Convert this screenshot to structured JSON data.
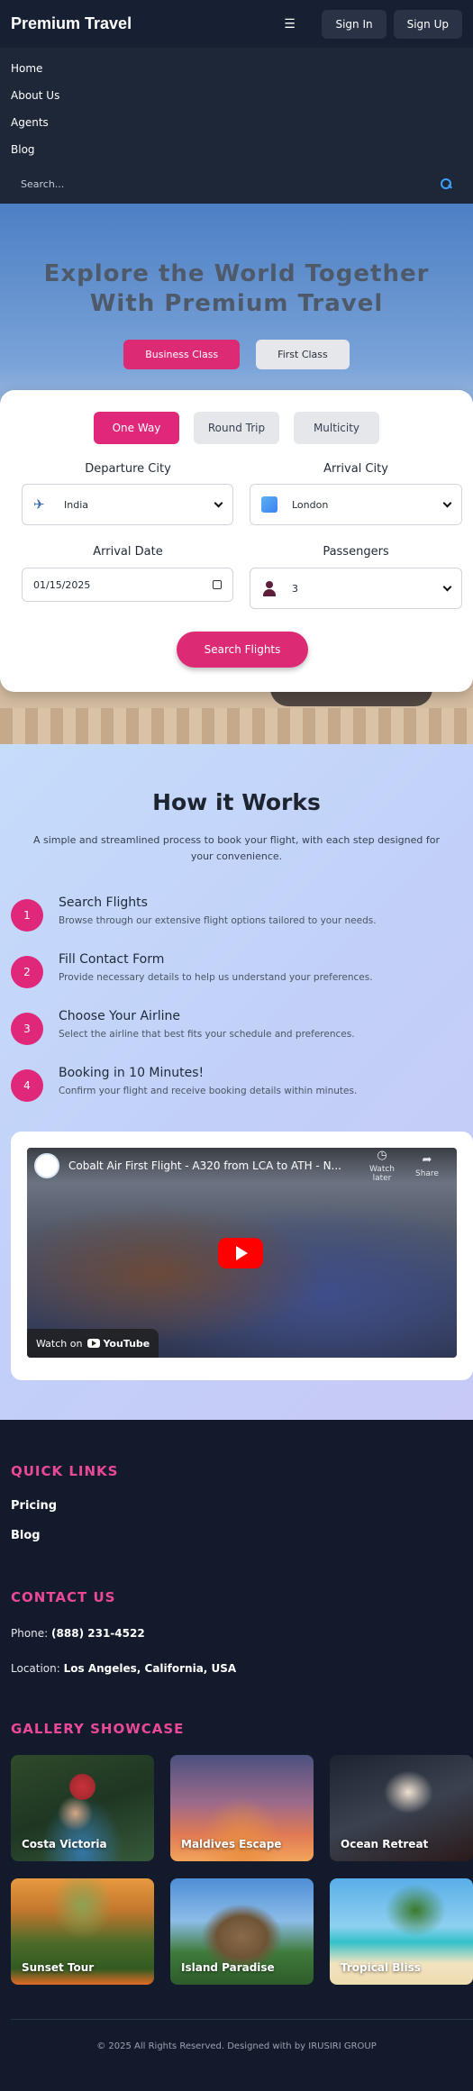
{
  "header": {
    "brand": "Premium Travel",
    "menu_icon": "hamburger-icon",
    "sign_in": "Sign In",
    "sign_up": "Sign Up"
  },
  "nav": {
    "items": [
      "Home",
      "About Us",
      "Agents",
      "Blog"
    ],
    "search_placeholder": "Search..."
  },
  "hero": {
    "title_line1": "Explore the World Together",
    "title_line2": "With Premium Travel",
    "class_buttons": [
      "Business Class",
      "First Class"
    ],
    "active_class": "Business Class"
  },
  "booking": {
    "trip_types": [
      "One Way",
      "Round Trip",
      "Multicity"
    ],
    "active_trip": "One Way",
    "departure_label": "Departure City",
    "departure_value": "India",
    "arrival_label": "Arrival City",
    "arrival_value": "London",
    "date_label": "Arrival Date",
    "date_value": "01/15/2025",
    "passengers_label": "Passengers",
    "passengers_value": "3",
    "submit": "Search Flights"
  },
  "how": {
    "title": "How it Works",
    "subtitle": "A simple and streamlined process to book your flight, with each step designed for your convenience.",
    "steps": [
      {
        "num": "1",
        "title": "Search Flights",
        "desc": "Browse through our extensive flight options tailored to your needs."
      },
      {
        "num": "2",
        "title": "Fill Contact Form",
        "desc": "Provide necessary details to help us understand your preferences."
      },
      {
        "num": "3",
        "title": "Choose Your Airline",
        "desc": "Select the airline that best fits your schedule and preferences."
      },
      {
        "num": "4",
        "title": "Booking in 10 Minutes!",
        "desc": "Confirm your flight and receive booking details within minutes."
      }
    ],
    "video": {
      "title": "Cobalt Air First Flight - A320 from LCA to ATH - N...",
      "watch_later": "Watch later",
      "share": "Share",
      "watch_on": "Watch on",
      "platform": "YouTube"
    }
  },
  "footer": {
    "quick_links_title": "QUICK LINKS",
    "quick_links": [
      "Pricing",
      "Blog"
    ],
    "contact_title": "CONTACT US",
    "phone_label": "Phone:",
    "phone_value": "(888) 231-4522",
    "location_label": "Location:",
    "location_value": "Los Angeles, California, USA",
    "gallery_title": "GALLERY SHOWCASE",
    "gallery": [
      "Costa Victoria",
      "Maldives Escape",
      "Ocean Retreat",
      "Sunset Tour",
      "Island Paradise",
      "Tropical Bliss"
    ],
    "copyright": "© 2025 All Rights Reserved. Designed with by IRUSIRI GROUP"
  }
}
